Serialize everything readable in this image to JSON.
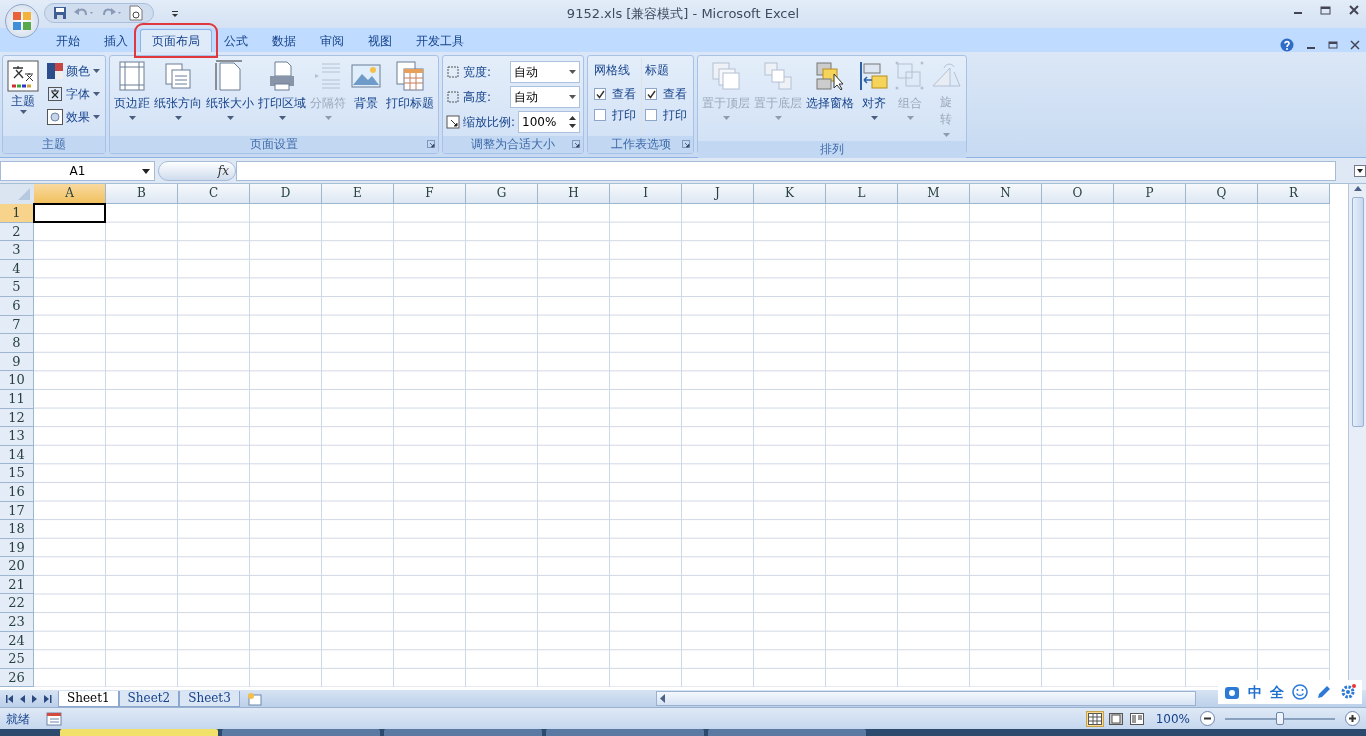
{
  "window": {
    "title": "9152.xls  [兼容模式] - Microsoft Excel"
  },
  "tabs": [
    {
      "label": "开始",
      "selected": false,
      "highlighted": false
    },
    {
      "label": "插入",
      "selected": false,
      "highlighted": false
    },
    {
      "label": "页面布局",
      "selected": true,
      "highlighted": true
    },
    {
      "label": "公式",
      "selected": false,
      "highlighted": false
    },
    {
      "label": "数据",
      "selected": false,
      "highlighted": false
    },
    {
      "label": "审阅",
      "selected": false,
      "highlighted": false
    },
    {
      "label": "视图",
      "selected": false,
      "highlighted": false
    },
    {
      "label": "开发工具",
      "selected": false,
      "highlighted": false
    }
  ],
  "ribbon": {
    "groups": [
      {
        "kind": "theme",
        "label": "主题",
        "launcher": false,
        "big": {
          "label": "主题",
          "dropdown": true
        },
        "small": [
          {
            "label": "颜色"
          },
          {
            "label": "字体"
          },
          {
            "label": "效果"
          }
        ]
      },
      {
        "kind": "buttons",
        "label": "页面设置",
        "launcher": true,
        "buttons": [
          {
            "label": "页边距",
            "dropdown": true,
            "disabled": false
          },
          {
            "label": "纸张方向",
            "dropdown": true,
            "disabled": false
          },
          {
            "label": "纸张大小",
            "dropdown": true,
            "disabled": false
          },
          {
            "label": "打印区域",
            "dropdown": true,
            "disabled": false
          },
          {
            "label": "分隔符",
            "dropdown": true,
            "disabled": true
          },
          {
            "label": "背景",
            "dropdown": false,
            "disabled": false
          },
          {
            "label": "打印标题",
            "dropdown": false,
            "disabled": false
          }
        ]
      },
      {
        "kind": "scale",
        "label": "调整为合适大小",
        "launcher": true,
        "fields": [
          {
            "label": "宽度:",
            "value": "自动",
            "kind": "dropdown"
          },
          {
            "label": "高度:",
            "value": "自动",
            "kind": "dropdown"
          },
          {
            "label": "缩放比例:",
            "value": "100%",
            "kind": "spinner"
          }
        ]
      },
      {
        "kind": "options",
        "label": "工作表选项",
        "launcher": true,
        "columns": [
          {
            "title": "网格线",
            "options": [
              {
                "label": "查看",
                "checked": true
              },
              {
                "label": "打印",
                "checked": false
              }
            ]
          },
          {
            "title": "标题",
            "options": [
              {
                "label": "查看",
                "checked": true
              },
              {
                "label": "打印",
                "checked": false
              }
            ]
          }
        ]
      },
      {
        "kind": "buttons",
        "label": "排列",
        "launcher": false,
        "buttons": [
          {
            "label": "置于顶层",
            "dropdown": true,
            "disabled": true
          },
          {
            "label": "置于底层",
            "dropdown": true,
            "disabled": true
          },
          {
            "label": "选择窗格",
            "dropdown": false,
            "disabled": false
          },
          {
            "label": "对齐",
            "dropdown": true,
            "disabled": false
          },
          {
            "label": "组合",
            "dropdown": true,
            "disabled": true
          },
          {
            "label": "旋转",
            "dropdown": true,
            "disabled": true
          }
        ]
      }
    ]
  },
  "formula_bar": {
    "name_box": "A1",
    "fx": "fx"
  },
  "sheet": {
    "columns": [
      {
        "label": "A",
        "selected": true
      },
      {
        "label": "B",
        "selected": false
      },
      {
        "label": "C",
        "selected": false
      },
      {
        "label": "D",
        "selected": false
      },
      {
        "label": "E",
        "selected": false
      },
      {
        "label": "F",
        "selected": false
      },
      {
        "label": "G",
        "selected": false
      },
      {
        "label": "H",
        "selected": false
      },
      {
        "label": "I",
        "selected": false
      },
      {
        "label": "J",
        "selected": false
      },
      {
        "label": "K",
        "selected": false
      },
      {
        "label": "L",
        "selected": false
      },
      {
        "label": "M",
        "selected": false
      },
      {
        "label": "N",
        "selected": false
      },
      {
        "label": "O",
        "selected": false
      },
      {
        "label": "P",
        "selected": false
      },
      {
        "label": "Q",
        "selected": false
      },
      {
        "label": "R",
        "selected": false
      }
    ],
    "rows": [
      {
        "label": "1",
        "selected": true
      },
      {
        "label": "2",
        "selected": false
      },
      {
        "label": "3",
        "selected": false
      },
      {
        "label": "4",
        "selected": false
      },
      {
        "label": "5",
        "selected": false
      },
      {
        "label": "6",
        "selected": false
      },
      {
        "label": "7",
        "selected": false
      },
      {
        "label": "8",
        "selected": false
      },
      {
        "label": "9",
        "selected": false
      },
      {
        "label": "10",
        "selected": false
      },
      {
        "label": "11",
        "selected": false
      },
      {
        "label": "12",
        "selected": false
      },
      {
        "label": "13",
        "selected": false
      },
      {
        "label": "14",
        "selected": false
      },
      {
        "label": "15",
        "selected": false
      },
      {
        "label": "16",
        "selected": false
      },
      {
        "label": "17",
        "selected": false
      },
      {
        "label": "18",
        "selected": false
      },
      {
        "label": "19",
        "selected": false
      },
      {
        "label": "20",
        "selected": false
      },
      {
        "label": "21",
        "selected": false
      },
      {
        "label": "22",
        "selected": false
      },
      {
        "label": "23",
        "selected": false
      },
      {
        "label": "24",
        "selected": false
      },
      {
        "label": "25",
        "selected": false
      },
      {
        "label": "26",
        "selected": false
      }
    ]
  },
  "sheet_tabs": [
    {
      "label": "Sheet1",
      "selected": true
    },
    {
      "label": "Sheet2",
      "selected": false
    },
    {
      "label": "Sheet3",
      "selected": false
    }
  ],
  "status_bar": {
    "text": "就绪",
    "views": [
      {
        "selected": true
      },
      {
        "selected": false
      },
      {
        "selected": false
      }
    ],
    "zoom": "100%",
    "zoom_slider": {
      "level": 0.5
    }
  },
  "ime_bar": {
    "items": [
      "中",
      "全"
    ]
  }
}
